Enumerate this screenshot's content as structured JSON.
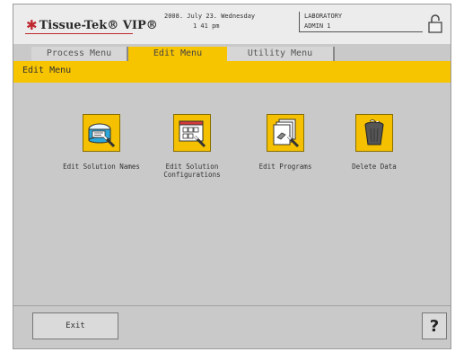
{
  "header": {
    "brand_name": "Tissue-Tek® VIP®",
    "date": "2008. July 23. Wednesday",
    "time": "1 41 pm",
    "location": "LABORATORY",
    "user": "ADMIN 1",
    "lock_icon": "padlock-icon",
    "brand_color": "#c0282f"
  },
  "tabs": [
    {
      "label": "Process Menu",
      "active": false
    },
    {
      "label": "Edit Menu",
      "active": true
    },
    {
      "label": "Utility Menu",
      "active": false
    }
  ],
  "page_title": "Edit Menu",
  "menu_items": [
    {
      "label": "Edit Solution Names",
      "icon": "solution-bottle-edit-icon"
    },
    {
      "label": "Edit Solution Configurations",
      "icon": "configuration-grid-edit-icon"
    },
    {
      "label": "Edit Programs",
      "icon": "program-pages-edit-icon"
    },
    {
      "label": "Delete Data",
      "icon": "trash-can-icon"
    }
  ],
  "footer": {
    "exit_label": "Exit",
    "help_label": "?"
  },
  "colors": {
    "accent": "#f7c400",
    "background": "#c9c9c9"
  }
}
